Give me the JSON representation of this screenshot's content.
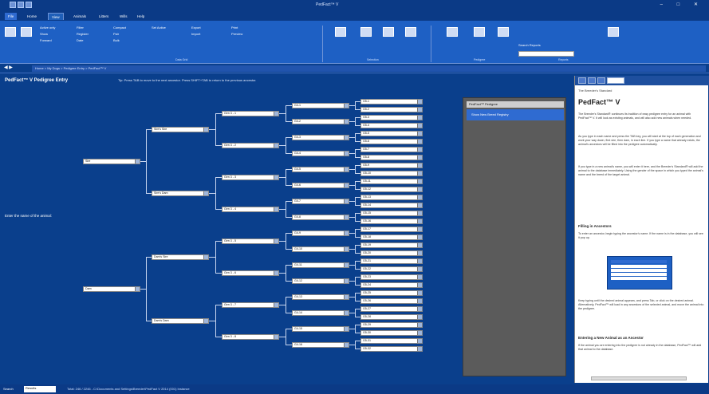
{
  "window": {
    "title": "PedFact™ V"
  },
  "tabs": [
    "File",
    "Home",
    "View",
    "Animals",
    "Litters",
    "Wills",
    "Help"
  ],
  "ribbon": {
    "items": [
      "Active only",
      "Show",
      "Forward",
      "Filter",
      "Register",
      "Date",
      "Compact",
      "Pair",
      "Bulk",
      "Set Active",
      "Export",
      "Import",
      "Print",
      "Preview",
      "Report"
    ],
    "groups": [
      "Data Grid",
      "Selection",
      "Pedigree",
      "Reports"
    ],
    "search_label": "Search Reports"
  },
  "address": {
    "path": "Home > My Dogs > Pedigree Entry > PedFact™ V"
  },
  "pedigree": {
    "title": "PedFact™ V Pedigree Entry",
    "instructions": "Tip: Press TAB to move to the next ancestor. Press SHIFT+TAB to return to the previous ancestor.",
    "animal_label": "Enter the name of the animal:",
    "gen1": [
      "Sire",
      "Dam"
    ],
    "gen2": [
      "Sire's Sire",
      "Sire's Dam",
      "Dam's Sire",
      "Dam's Dam"
    ],
    "gen3": [
      "Gen 3 - 1",
      "Gen 3 - 2",
      "Gen 3 - 3",
      "Gen 3 - 4",
      "Gen 3 - 5",
      "Gen 3 - 6",
      "Gen 3 - 7",
      "Gen 3 - 8"
    ],
    "gen4": [
      "G4-1",
      "G4-2",
      "G4-3",
      "G4-4",
      "G4-5",
      "G4-6",
      "G4-7",
      "G4-8",
      "G4-9",
      "G4-10",
      "G4-11",
      "G4-12",
      "G4-13",
      "G4-14",
      "G4-15",
      "G4-16"
    ],
    "gen5": [
      "G5-1",
      "G5-2",
      "G5-3",
      "G5-4",
      "G5-5",
      "G5-6",
      "G5-7",
      "G5-8",
      "G5-9",
      "G5-10",
      "G5-11",
      "G5-12",
      "G5-13",
      "G5-14",
      "G5-15",
      "G5-16",
      "G5-17",
      "G5-18",
      "G5-19",
      "G5-20",
      "G5-21",
      "G5-22",
      "G5-23",
      "G5-24",
      "G5-25",
      "G5-26",
      "G5-27",
      "G5-28",
      "G5-29",
      "G5-30",
      "G5-31",
      "G5-32"
    ]
  },
  "pedigree_tools": {
    "header": "PedFact™ Pedigree",
    "button": "Show New Breed Registry"
  },
  "help": {
    "subtitle": "The Breeder's Standard",
    "title": "PedFact™ V",
    "p1": "The Breeder's Standard® continues its tradition of easy pedigree entry for an animal with PedFact™ V. It will look as existing animals, and will also add new animals when needed.",
    "p2": "As you type in each name and press the TAB key, you will start at the top of each generation and work your way down, first sire, then dam, in each line. If you type a name that already exists, the animal's ancestors will be filled into the pedigree automatically.",
    "p3": "If you type in a new animal's name, you will enter it here, and the Breeder's Standard® will add the animal to the database immediately. Using the gender of the space in which you typed the animal's name and the breed of the target animal.",
    "h_fill": "Filling in Ancestors",
    "p4": "To enter an ancestor, begin typing the ancestor's name. If the name is in the database, you will see it pop up.",
    "p5": "Keep typing until the desired animal appears, and press Tab, or click on the desired animal. Alternatively, PedFact™ will load in any ancestors of the selected animal, and move the animal into the pedigree.",
    "h_new": "Entering a New Animal as an Ancestor",
    "p6": "If the animal you are entering into the pedigree is not already in the database, PedFact™ will add that animal to the database."
  },
  "status": {
    "label": "Search",
    "value": "Results",
    "info": "Total: 246 / 2246 - C:\\Documents and Settings\\Breeder\\PedFact V 2014 (001) Instance"
  }
}
